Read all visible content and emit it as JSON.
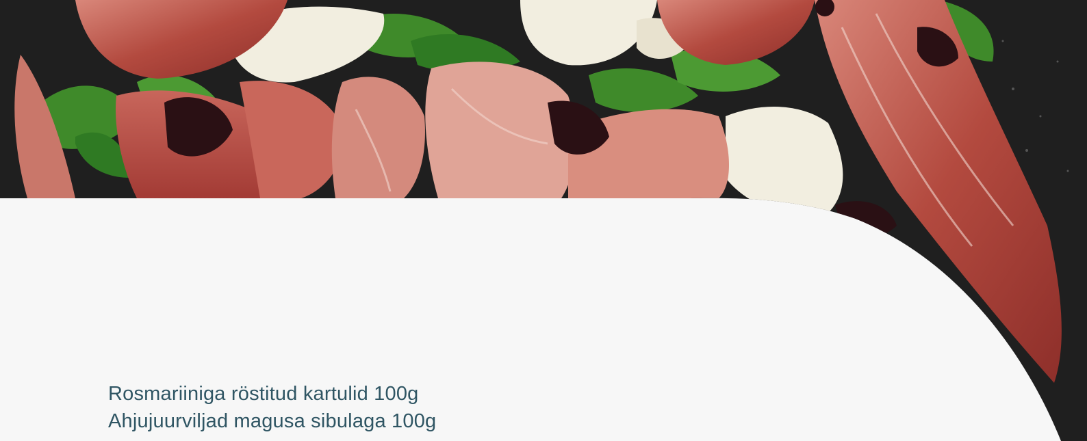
{
  "menu": {
    "items": [
      {
        "label": "Rosmariiniga röstitud kartulid 100g"
      },
      {
        "label": "Ahjujuurviljad magusa sibulaga 100g"
      }
    ]
  },
  "colors": {
    "background": "#f7f7f7",
    "text": "#2f5563",
    "plate": "#1f1f1f",
    "prosciutto": "#b95a4d",
    "arugula": "#3f8a2a",
    "cheese": "#f2eee0",
    "balsamic": "#2a1014"
  },
  "hero_image": {
    "description_icon": "salad-photo",
    "content": "prosciutto-arugula-mozzarella-salad"
  }
}
